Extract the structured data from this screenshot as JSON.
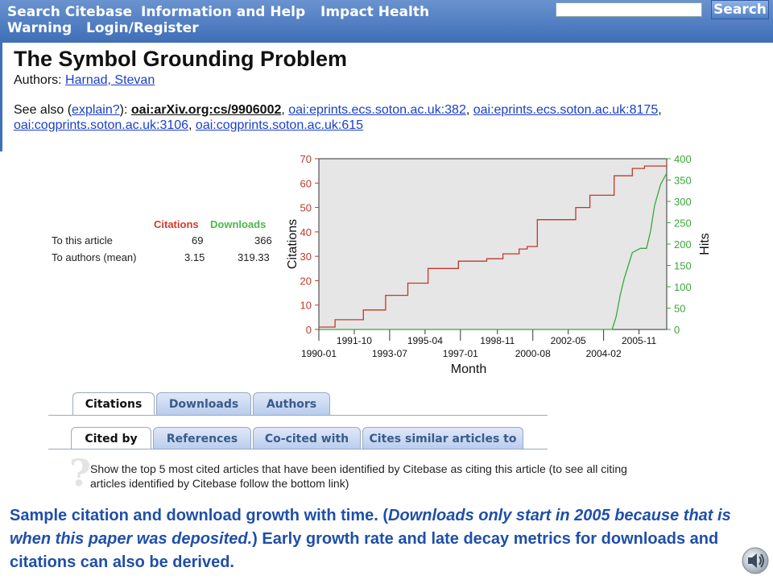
{
  "nav": {
    "items": [
      "Search Citebase",
      "Information and Help",
      "Impact Health",
      "Warning",
      "Login/Register"
    ],
    "search_placeholder": "",
    "search_button": "Search"
  },
  "paper": {
    "title": "The Symbol Grounding Problem",
    "authors_label": "Authors:",
    "author": "Harnad, Stevan",
    "see_also_label": "See also (",
    "explain_link": "explain?",
    "see_also_colon": "):",
    "see_also_links": [
      "oai:arXiv.org:cs/9906002",
      "oai:eprints.ecs.soton.ac.uk:382",
      "oai:eprints.ecs.soton.ac.uk:8175",
      "oai:cogprints.soton.ac.uk:3106",
      "oai:cogprints.soton.ac.uk:615"
    ]
  },
  "stats": {
    "col_citations": "Citations",
    "col_downloads": "Downloads",
    "rows": [
      {
        "label": "To this article",
        "citations": "69",
        "downloads": "366"
      },
      {
        "label": "To authors (mean)",
        "citations": "3.15",
        "downloads": "319.33"
      }
    ]
  },
  "chart_data": {
    "type": "line",
    "xlabel": "Month",
    "ylabel": "Citations",
    "y2label": "Hits",
    "ylim": [
      0,
      70
    ],
    "y2lim": [
      0,
      400
    ],
    "yticks": [
      0,
      10,
      20,
      30,
      40,
      50,
      60,
      70
    ],
    "y2ticks": [
      0,
      50,
      100,
      150,
      200,
      250,
      300,
      350,
      400
    ],
    "xlim": [
      1990.0,
      2007.2
    ],
    "xticks_top": [
      "1991-10",
      "1995-04",
      "1998-11",
      "2002-05",
      "2005-11"
    ],
    "xticks_bottom": [
      "1990-01",
      "1993-07",
      "1997-01",
      "2000-08",
      "2004-02"
    ],
    "xticks_top_pos": [
      1991.75,
      1995.25,
      1998.83,
      2002.33,
      2005.83
    ],
    "xticks_bottom_pos": [
      1990.0,
      1993.5,
      1997.0,
      2000.58,
      2004.08
    ],
    "grid": false,
    "series": [
      {
        "name": "Citations",
        "color": "#c0392b",
        "axis": "left",
        "x": [
          1990.0,
          1990.8,
          1991.2,
          1992.2,
          1992.6,
          1993.3,
          1993.9,
          1994.4,
          1995.4,
          1996.0,
          1996.9,
          1997.5,
          1998.3,
          1999.1,
          1999.9,
          2000.3,
          2000.8,
          2001.7,
          2002.7,
          2003.4,
          2004.6,
          2005.5,
          2006.1,
          2007.2
        ],
        "y": [
          1,
          4,
          4,
          8,
          8,
          14,
          14,
          19,
          25,
          25,
          28,
          28,
          29,
          31,
          33,
          34,
          45,
          45,
          50,
          55,
          63,
          66,
          67,
          69
        ]
      },
      {
        "name": "Downloads",
        "color": "#3aa83a",
        "axis": "right",
        "x": [
          1990.0,
          2004.5,
          2004.7,
          2004.9,
          2005.1,
          2005.3,
          2005.5,
          2005.9,
          2006.2,
          2006.4,
          2006.6,
          2006.9,
          2007.2
        ],
        "y": [
          0,
          0,
          30,
          80,
          120,
          150,
          180,
          190,
          190,
          230,
          290,
          340,
          366
        ]
      }
    ]
  },
  "tabs_row1": [
    "Citations",
    "Downloads",
    "Authors"
  ],
  "tabs_row2": [
    "Cited by",
    "References",
    "Co-cited with",
    "Cites similar articles to"
  ],
  "help_text": "Show the top 5 most cited articles that have been identified by Citebase as citing this article (to see all citing articles identified by Citebase follow the bottom link)",
  "caption": {
    "part1": "Sample citation and download growth with time. (",
    "italic": "Downloads only start in 2005 because that is when this paper was deposited.",
    "part2": ") Early growth rate and late decay metrics for downloads and citations can also be derived."
  }
}
